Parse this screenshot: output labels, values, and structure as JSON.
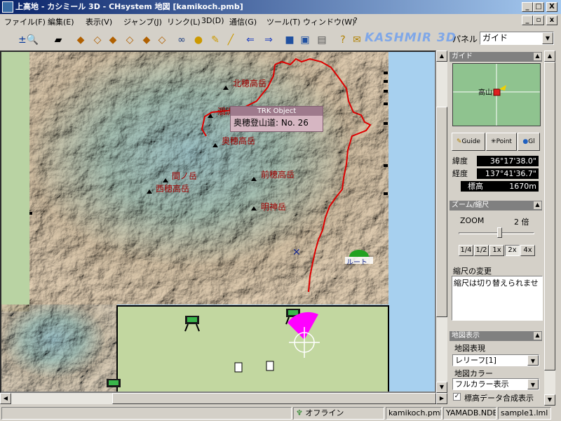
{
  "window": {
    "title": "上高地 - カシミール 3D - CHsystem 地図 [kamikoch.pmb]",
    "minimize": "_",
    "maximize": "□",
    "close": "X"
  },
  "menu": [
    "ファイル(F)",
    "編集(E)",
    "表示(V)",
    "ジャンプ(J)",
    "リンク(L)",
    "3D(D)",
    "通信(G)",
    "ツール(T)",
    "ウィンドウ(W)",
    "?"
  ],
  "toolbar": {
    "icons": [
      "zoom-icon",
      "layer-icon",
      "map-icon",
      "map2-icon",
      "map3-icon",
      "map4-icon",
      "map5-icon",
      "binoculars-icon",
      "palette-icon",
      "ruler-icon",
      "arrow-left-icon",
      "arrow-right-icon",
      "camera-icon",
      "monitor-icon",
      "trash-icon",
      "help-icon",
      "go-icon"
    ],
    "brand": "KASHMIR 3D"
  },
  "panel_selector": {
    "label": "パネル",
    "value": "ガイド"
  },
  "map": {
    "peaks": [
      {
        "name": "北穂高岳"
      },
      {
        "name": "涸沢"
      },
      {
        "name": "奥穂高岳"
      },
      {
        "name": "前穂高岳"
      },
      {
        "name": "間ノ岳"
      },
      {
        "name": "西穂高岳"
      },
      {
        "name": "明神岳"
      }
    ],
    "tooltip_header": "TRK Object",
    "tooltip_text": "奥穂登山道: No. 26",
    "route_label": "ルート"
  },
  "guide": {
    "header": "ガイド",
    "map_label": "高山",
    "tabs": [
      "Guide",
      "Point",
      "Gl"
    ],
    "lat_label": "緯度",
    "lat_value": "36°17'38.0\"",
    "lon_label": "経度",
    "lon_value": "137°41'36.7\"",
    "alt_label": "標高",
    "alt_value": "1670m"
  },
  "zoom": {
    "header": "ズーム/縮尺",
    "label": "ZOOM",
    "value": "2 倍",
    "level": 0.55,
    "buttons": [
      "1/4",
      "1/2",
      "1x",
      "2x",
      "4x"
    ],
    "scale_label": "縮尺の変更",
    "scale_text": "縮尺は切り替えられませ"
  },
  "mapdisplay": {
    "header": "地図表示",
    "repr_label": "地図表現",
    "repr_value": "レリーフ[1]",
    "color_label": "地図カラー",
    "color_value": "フルカラー表示",
    "elev_checkbox": "標高データ合成表示",
    "elev_checked": true
  },
  "status": {
    "online": "オフライン",
    "file": "kamikoch.pmb",
    "db": "YAMADB.NDB",
    "lml": "sample1.lml"
  }
}
